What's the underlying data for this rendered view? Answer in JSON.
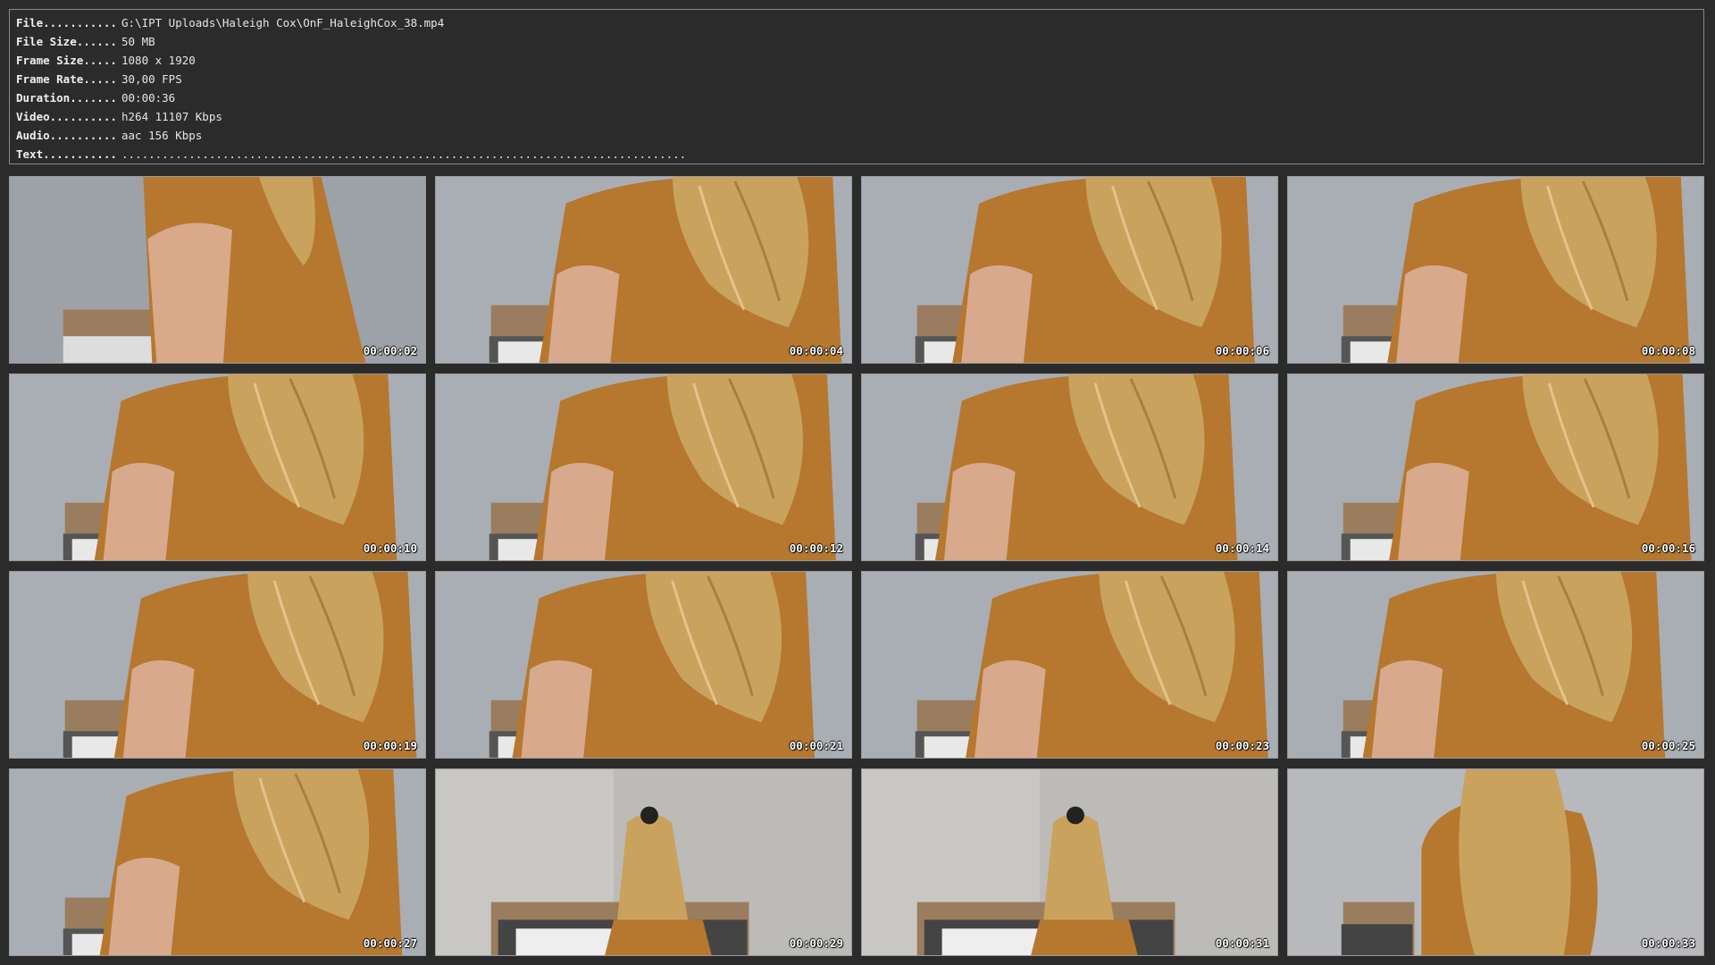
{
  "info": [
    {
      "key": "File...........",
      "value": "G:\\IPT Uploads\\Haleigh Cox\\OnF_HaleighCox_38.mp4"
    },
    {
      "key": "File Size......",
      "value": "50 MB"
    },
    {
      "key": "Frame Size.....",
      "value": "1080 x 1920"
    },
    {
      "key": "Frame Rate.....",
      "value": "30,00 FPS"
    },
    {
      "key": "Duration.......",
      "value": "00:00:36"
    },
    {
      "key": "Video..........",
      "value": "h264 11107 Kbps"
    },
    {
      "key": "Audio..........",
      "value": "aac 156 Kbps"
    },
    {
      "key": "Text...........",
      "value": "...................................................................................."
    }
  ],
  "thumbnails": [
    {
      "timestamp": "00:00:02",
      "scene": "close"
    },
    {
      "timestamp": "00:00:04",
      "scene": "back"
    },
    {
      "timestamp": "00:00:06",
      "scene": "back"
    },
    {
      "timestamp": "00:00:08",
      "scene": "back"
    },
    {
      "timestamp": "00:00:10",
      "scene": "back"
    },
    {
      "timestamp": "00:00:12",
      "scene": "back"
    },
    {
      "timestamp": "00:00:14",
      "scene": "back"
    },
    {
      "timestamp": "00:00:16",
      "scene": "back"
    },
    {
      "timestamp": "00:00:19",
      "scene": "back"
    },
    {
      "timestamp": "00:00:21",
      "scene": "back"
    },
    {
      "timestamp": "00:00:23",
      "scene": "back"
    },
    {
      "timestamp": "00:00:25",
      "scene": "back"
    },
    {
      "timestamp": "00:00:27",
      "scene": "back"
    },
    {
      "timestamp": "00:00:29",
      "scene": "far"
    },
    {
      "timestamp": "00:00:31",
      "scene": "far"
    },
    {
      "timestamp": "00:00:33",
      "scene": "hair"
    }
  ],
  "colors": {
    "background": "#2b2b2b",
    "panel_border": "#8a8a8a",
    "text": "#e6e6e6",
    "wall": "#a9aeb4",
    "wall_light": "#c9c7c3",
    "dress": "#b5782e",
    "hair": "#c9a25e",
    "bed_frame": "#9a7d5e"
  }
}
